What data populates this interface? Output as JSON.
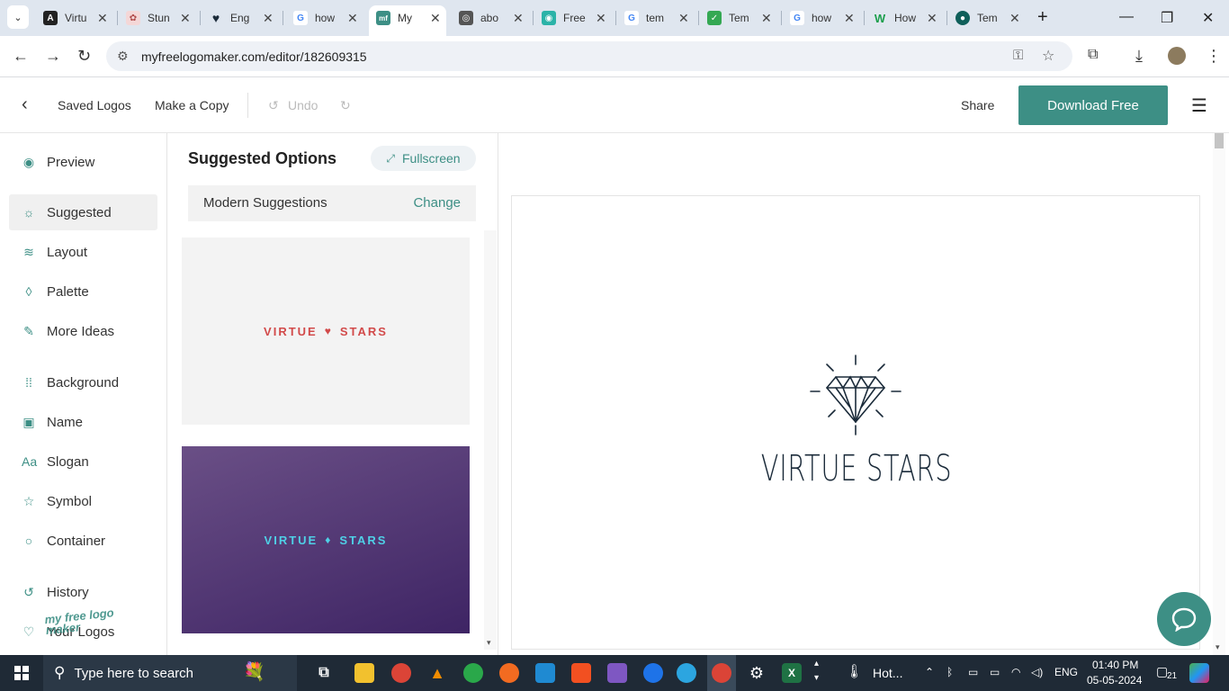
{
  "browser": {
    "tabs": [
      {
        "label": "Virtu",
        "fav": "A"
      },
      {
        "label": "Stun",
        "fav": "✿"
      },
      {
        "label": "Eng",
        "fav": "♥"
      },
      {
        "label": "how",
        "fav": "G"
      },
      {
        "label": "My",
        "fav": "mf"
      },
      {
        "label": "abo",
        "fav": "◎"
      },
      {
        "label": "Free",
        "fav": "◉"
      },
      {
        "label": "tem",
        "fav": "G"
      },
      {
        "label": "Tem",
        "fav": "✓"
      },
      {
        "label": "how",
        "fav": "G"
      },
      {
        "label": "How",
        "fav": "W"
      },
      {
        "label": "Tem",
        "fav": "●"
      }
    ],
    "url": "myfreelogomaker.com/editor/182609315"
  },
  "header": {
    "saved_logos": "Saved Logos",
    "make_copy": "Make a Copy",
    "undo": "Undo",
    "share": "Share",
    "download": "Download Free"
  },
  "sidebar": {
    "items": [
      {
        "label": "Preview",
        "icon": "eye-icon"
      },
      {
        "label": "Suggested",
        "icon": "bulb-icon"
      },
      {
        "label": "Layout",
        "icon": "layers-icon"
      },
      {
        "label": "Palette",
        "icon": "drop-icon"
      },
      {
        "label": "More Ideas",
        "icon": "pin-icon"
      },
      {
        "label": "Background",
        "icon": "grid-icon"
      },
      {
        "label": "Name",
        "icon": "text-box-icon"
      },
      {
        "label": "Slogan",
        "icon": "font-icon"
      },
      {
        "label": "Symbol",
        "icon": "star-icon"
      },
      {
        "label": "Container",
        "icon": "circle-icon"
      },
      {
        "label": "History",
        "icon": "history-icon"
      },
      {
        "label": "Your Logos",
        "icon": "heart-icon"
      }
    ],
    "watermark": "my free logo maker"
  },
  "panel": {
    "title": "Suggested Options",
    "fullscreen": "Fullscreen",
    "suggestion_type": "Modern Suggestions",
    "change": "Change",
    "card1_left": "VIRTUE",
    "card1_right": "STARS",
    "card2_left": "VIRTUE",
    "card2_right": "STARS"
  },
  "canvas": {
    "logo_text": "VIRTUE STARS"
  },
  "taskbar": {
    "search_placeholder": "Type here to search",
    "weather": "Hot...",
    "lang": "ENG",
    "time": "01:40 PM",
    "date": "05-05-2024",
    "notifications": "21"
  },
  "colors": {
    "accent": "#3d8f85",
    "card1_text": "#d24a4a",
    "card2_bg": "#4a3070",
    "card2_text": "#4fd0e6",
    "logo": "#1b2b3a"
  }
}
